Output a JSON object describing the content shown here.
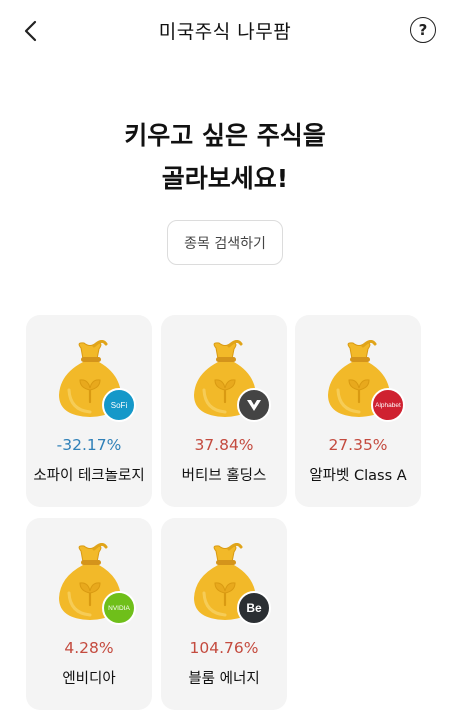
{
  "header": {
    "title": "미국주식 나무팜"
  },
  "headline": {
    "line1": "키우고 싶은 주식을",
    "line2": "골라보세요!"
  },
  "search": {
    "label": "종목 검색하기"
  },
  "colors": {
    "up": "#c44b3f",
    "down": "#2f80b8",
    "bag": "#f2b929",
    "card_bg": "#f4f4f4"
  },
  "stocks": [
    {
      "name": "소파이 테크놀로지",
      "change": "-32.17%",
      "direction": "down",
      "logo_text": "SoFi",
      "logo_color": "#1598c9",
      "logo_icon": "sofi-logo-icon"
    },
    {
      "name": "버티브 홀딩스",
      "change": "37.84%",
      "direction": "up",
      "logo_text": "",
      "logo_color": "#444444",
      "logo_icon": "vertiv-logo-icon"
    },
    {
      "name": "알파벳 Class A",
      "change": "27.35%",
      "direction": "up",
      "logo_text": "Alphabet",
      "logo_color": "#cf2130",
      "logo_icon": "alphabet-logo-icon"
    },
    {
      "name": "엔비디아",
      "change": "4.28%",
      "direction": "up",
      "logo_text": "NVIDIA",
      "logo_color": "#6fbf1a",
      "logo_icon": "nvidia-logo-icon"
    },
    {
      "name": "블룸 에너지",
      "change": "104.76%",
      "direction": "up",
      "logo_text": "Be",
      "logo_color": "#2b2f33",
      "logo_icon": "bloom-energy-logo-icon"
    }
  ]
}
